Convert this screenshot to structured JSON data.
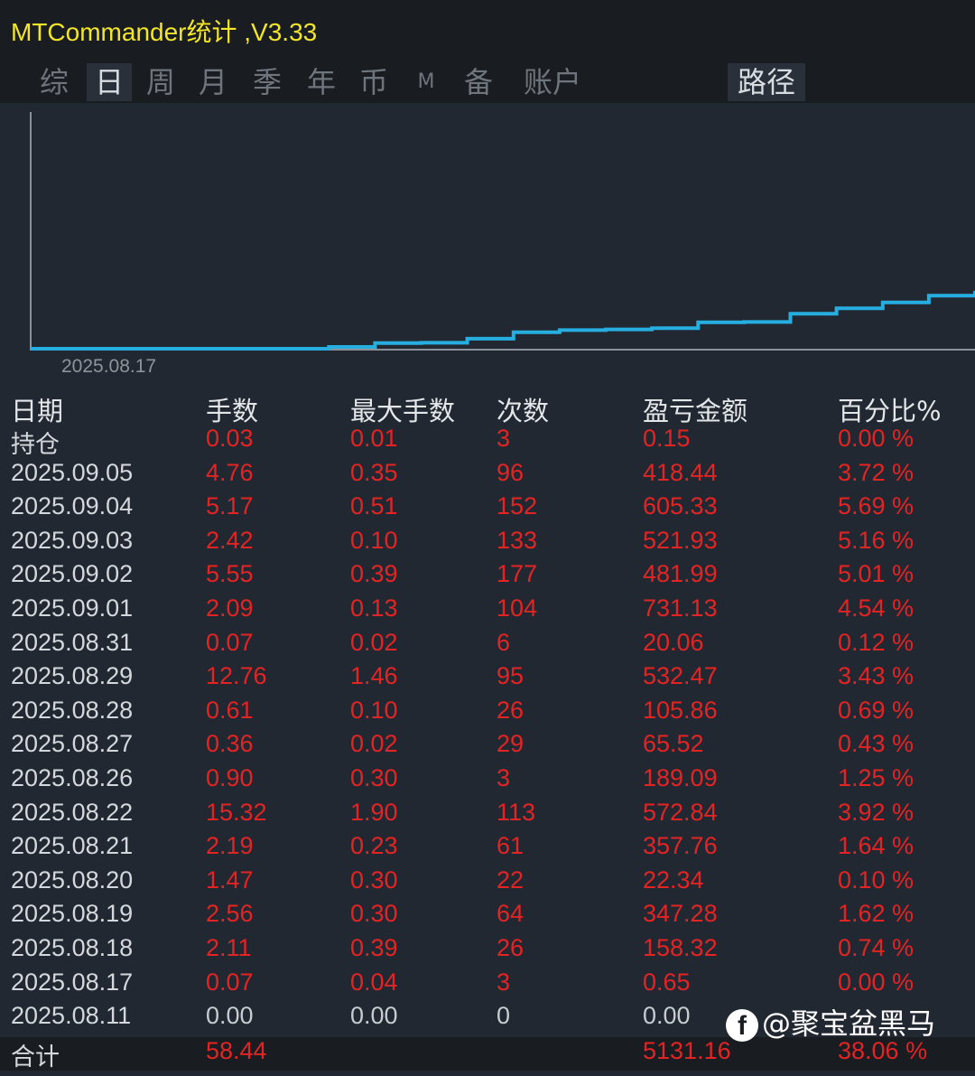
{
  "app": {
    "title": "MTCommander统计 ,V3.33"
  },
  "tabs": [
    "综",
    "日",
    "周",
    "月",
    "季",
    "年",
    "币",
    "M",
    "备",
    "账户"
  ],
  "active_tab": "日",
  "path_button": "路径",
  "chart_data": {
    "type": "line",
    "x_start_label": "2025.08.17",
    "series": [
      {
        "values": [
          0.65,
          158.32,
          347.28,
          22.34,
          357.76,
          572.84,
          189.09,
          65.52,
          105.86,
          532.47,
          20.06,
          731.13,
          481.99,
          521.93,
          605.33,
          418.44
        ]
      }
    ],
    "cumulative": true,
    "line_color": "#27aee0"
  },
  "table": {
    "headers": [
      "日期",
      "手数",
      "最大手数",
      "次数",
      "盈亏金额",
      "百分比%"
    ],
    "rows": [
      [
        "持仓",
        "0.03",
        "0.01",
        "3",
        "0.15",
        "0.00 %"
      ],
      [
        "2025.09.05",
        "4.76",
        "0.35",
        "96",
        "418.44",
        "3.72 %"
      ],
      [
        "2025.09.04",
        "5.17",
        "0.51",
        "152",
        "605.33",
        "5.69 %"
      ],
      [
        "2025.09.03",
        "2.42",
        "0.10",
        "133",
        "521.93",
        "5.16 %"
      ],
      [
        "2025.09.02",
        "5.55",
        "0.39",
        "177",
        "481.99",
        "5.01 %"
      ],
      [
        "2025.09.01",
        "2.09",
        "0.13",
        "104",
        "731.13",
        "4.54 %"
      ],
      [
        "2025.08.31",
        "0.07",
        "0.02",
        "6",
        "20.06",
        "0.12 %"
      ],
      [
        "2025.08.29",
        "12.76",
        "1.46",
        "95",
        "532.47",
        "3.43 %"
      ],
      [
        "2025.08.28",
        "0.61",
        "0.10",
        "26",
        "105.86",
        "0.69 %"
      ],
      [
        "2025.08.27",
        "0.36",
        "0.02",
        "29",
        "65.52",
        "0.43 %"
      ],
      [
        "2025.08.26",
        "0.90",
        "0.30",
        "3",
        "189.09",
        "1.25 %"
      ],
      [
        "2025.08.22",
        "15.32",
        "1.90",
        "113",
        "572.84",
        "3.92 %"
      ],
      [
        "2025.08.21",
        "2.19",
        "0.23",
        "61",
        "357.76",
        "1.64 %"
      ],
      [
        "2025.08.20",
        "1.47",
        "0.30",
        "22",
        "22.34",
        "0.10 %"
      ],
      [
        "2025.08.19",
        "2.56",
        "0.30",
        "64",
        "347.28",
        "1.62 %"
      ],
      [
        "2025.08.18",
        "2.11",
        "0.39",
        "26",
        "158.32",
        "0.74 %"
      ],
      [
        "2025.08.17",
        "0.07",
        "0.04",
        "3",
        "0.65",
        "0.00 %"
      ],
      [
        "2025.08.11",
        "0.00",
        "0.00",
        "0",
        "0.00",
        ""
      ]
    ],
    "total": [
      "合计",
      "58.44",
      "",
      "",
      "5131.16",
      "38.06 %"
    ]
  },
  "colors": {
    "value_red": "#e32424",
    "title_yellow": "#f2e52a"
  },
  "watermark": {
    "icon": "facebook-icon",
    "icon_glyph": "f",
    "text": "@聚宝盆黑马"
  }
}
